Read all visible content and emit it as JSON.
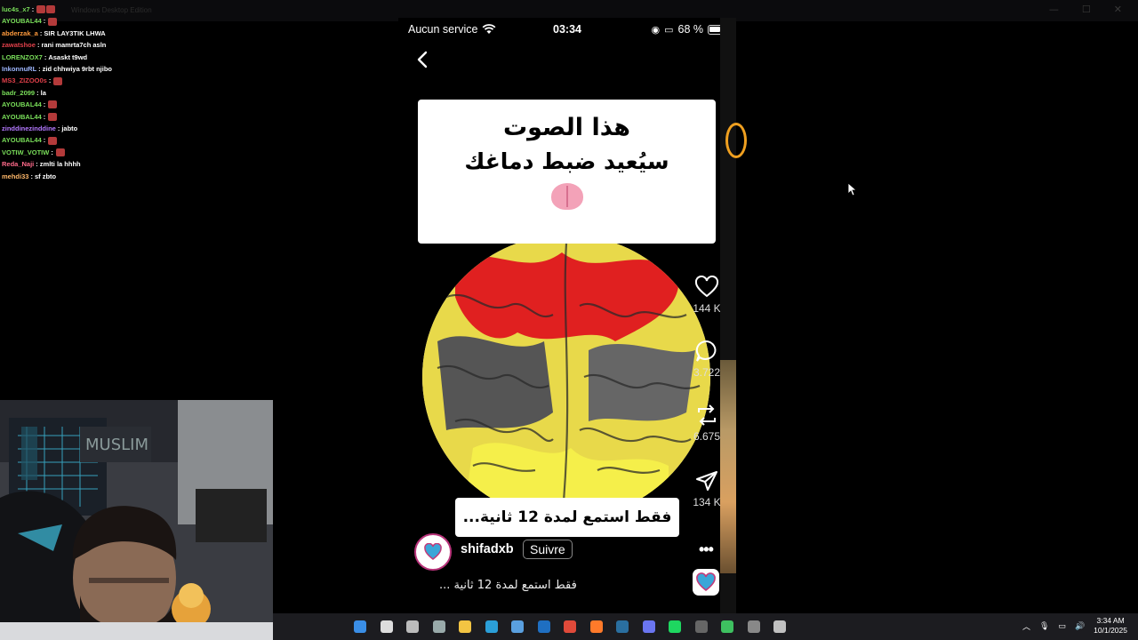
{
  "window": {
    "title": "Windows Desktop Edition"
  },
  "chat": [
    {
      "user": "luc4s_x7",
      "color": "#7adf5a",
      "text": "",
      "emotes": 2
    },
    {
      "user": "AYOUBAL44",
      "color": "#7adf5a",
      "text": "",
      "emotes": 1
    },
    {
      "user": "abderzak_a",
      "color": "#ff9a3c",
      "text": "SIR LAY3TIK LHWA",
      "emotes": 0
    },
    {
      "user": "zawatshoe",
      "color": "#e0404a",
      "text": "rani mamrta7ch asln",
      "emotes": 0
    },
    {
      "user": "LORENZOX7",
      "color": "#7adf5a",
      "text": "Asaskt t9wd",
      "emotes": 0
    },
    {
      "user": "InkonnuRL",
      "color": "#9fb7ff",
      "text": "zid chhwiya 9rbt njibo",
      "emotes": 0
    },
    {
      "user": "MS3_ZIZOO0s",
      "color": "#e0404a",
      "text": "",
      "emotes": 1
    },
    {
      "user": "badr_2099",
      "color": "#7adf5a",
      "text": "la",
      "emotes": 0
    },
    {
      "user": "AYOUBAL44",
      "color": "#7adf5a",
      "text": "",
      "emotes": 1
    },
    {
      "user": "AYOUBAL44",
      "color": "#7adf5a",
      "text": "",
      "emotes": 1
    },
    {
      "user": "zinddinezinddine",
      "color": "#b479ff",
      "text": "jabto",
      "emotes": 0
    },
    {
      "user": "AYOUBAL44",
      "color": "#7adf5a",
      "text": "",
      "emotes": 1
    },
    {
      "user": "VOTIW_VOTIW",
      "color": "#7adf5a",
      "text": "",
      "emotes": 1
    },
    {
      "user": "Reda_Naji",
      "color": "#ff6a8a",
      "text": "zmlti la hhhh",
      "emotes": 0
    },
    {
      "user": "mehdi33",
      "color": "#ffb86a",
      "text": "sf zbto",
      "emotes": 0
    }
  ],
  "phone": {
    "status": {
      "carrier": "Aucun service",
      "time": "03:34",
      "battery": "68 %",
      "battery_level": 0.68
    },
    "caption": {
      "line1": "هذا الصوت",
      "line2": "سيُعيد ضبط دماغك"
    },
    "subtitle": "فقط استمع لمدة 12 ثانية...",
    "actions": {
      "likes": "144 K",
      "comments": "3.722",
      "reposts": "6.675",
      "shares": "134 K"
    },
    "author": {
      "username": "shifadxb",
      "follow_label": "Suivre",
      "brand": "SHIFADXB",
      "more": "•••"
    },
    "description": "فقط استمع لمدة 12 ثانية ..."
  },
  "taskbar": {
    "time": "3:34 AM",
    "date": "10/1/2025"
  }
}
